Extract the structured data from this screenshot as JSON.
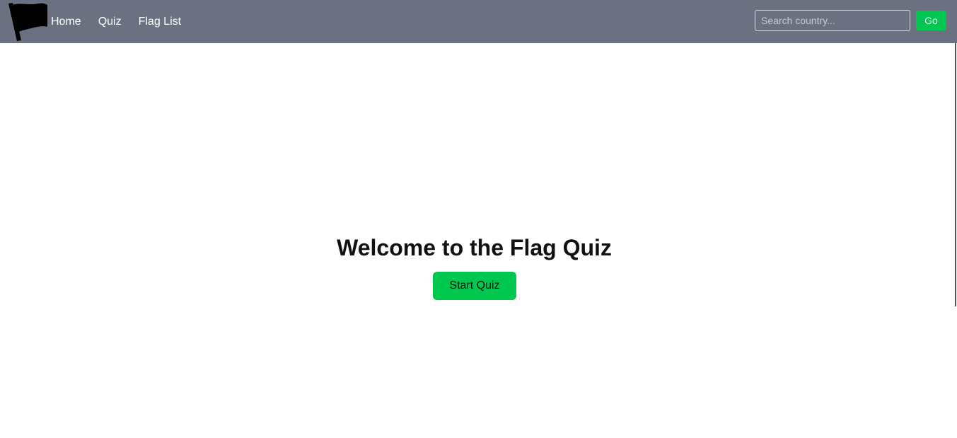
{
  "navbar": {
    "logo_icon": "black-flag-icon",
    "links": [
      {
        "label": "Home"
      },
      {
        "label": "Quiz"
      },
      {
        "label": "Flag List"
      }
    ],
    "search": {
      "value": "",
      "placeholder": "Search country..."
    },
    "go_label": "Go"
  },
  "hero": {
    "title": "Welcome to the Flag Quiz",
    "start_label": "Start Quiz"
  },
  "colors": {
    "navbar_background": "#6b7180",
    "accent_green": "#00c74f",
    "text_dark": "#111111"
  }
}
